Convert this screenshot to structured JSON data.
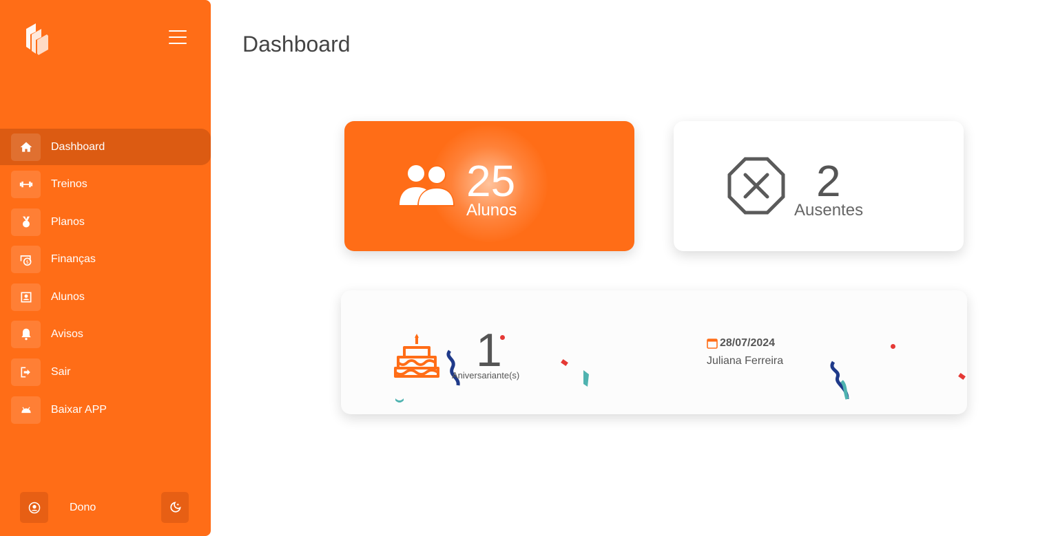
{
  "sidebar": {
    "items": [
      {
        "label": "Dashboard",
        "icon": "home-icon",
        "active": true
      },
      {
        "label": "Treinos",
        "icon": "dumbbell-icon"
      },
      {
        "label": "Planos",
        "icon": "medal-icon"
      },
      {
        "label": "Finanças",
        "icon": "money-icon"
      },
      {
        "label": "Alunos",
        "icon": "user-card-icon"
      },
      {
        "label": "Avisos",
        "icon": "bell-icon"
      },
      {
        "label": "Sair",
        "icon": "logout-icon"
      },
      {
        "label": "Baixar APP",
        "icon": "android-icon"
      }
    ],
    "footer": {
      "user_name": "Dono"
    }
  },
  "page": {
    "title": "Dashboard"
  },
  "cards": {
    "alunos": {
      "value": "25",
      "label": "Alunos"
    },
    "ausentes": {
      "value": "2",
      "label": "Ausentes"
    },
    "aniversariantes": {
      "value": "1",
      "label": "Aniversariante(s)",
      "date": "28/07/2024",
      "name": "Juliana Ferreira"
    }
  },
  "colors": {
    "accent": "#ff6d17",
    "accent_dark": "#dc5b12"
  }
}
